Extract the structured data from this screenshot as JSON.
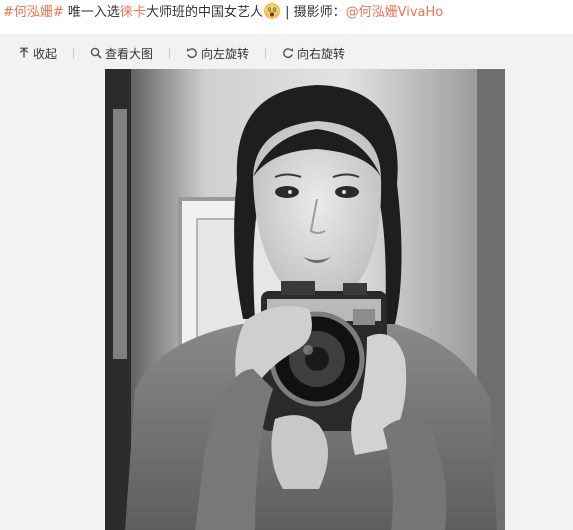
{
  "post": {
    "topic": "#何泓姗#",
    "text_before": " 唯一入选",
    "brand_link": "徕卡",
    "text_after": "大师班的中国女艺人",
    "emoji": "scared-face-emoji",
    "separator": " | ",
    "photographer_label": "摄影师：",
    "mention": "@何泓姗VivaHo"
  },
  "toolbar": {
    "collapse": "收起",
    "view_large": "查看大图",
    "rotate_left": "向左旋转",
    "rotate_right": "向右旋转"
  },
  "photo": {
    "subject": "black-and-white-portrait-with-camera"
  },
  "colors": {
    "link": "#eb7350",
    "text": "#333333",
    "media_background": "#f2f2f5"
  }
}
